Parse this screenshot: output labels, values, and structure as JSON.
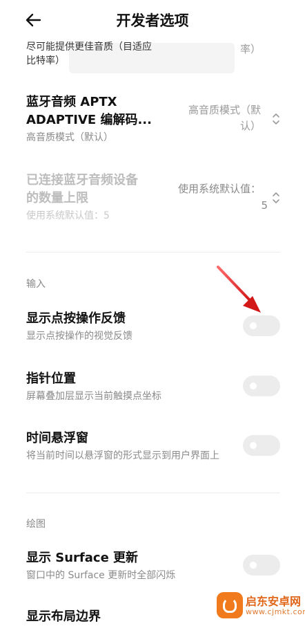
{
  "header": {
    "title": "开发者选项"
  },
  "top_partial": {
    "line1": "尽可能提供更佳音质（目适应",
    "line2": "比特率）",
    "value_tail": "率）"
  },
  "aptx": {
    "title_line1": "蓝牙音频 APTX",
    "title_line2": "ADAPTIVE 编解码...",
    "subtitle": "高音质模式（默认）",
    "value_line1": "高音质模式（默",
    "value_line2": "认）"
  },
  "bt_limit": {
    "title_line1": "已连接蓝牙音频设备",
    "title_line2": "的数量上限",
    "subtitle": "使用系统默认值：5",
    "value_line1": "使用系统默认值：",
    "value_line2": "5"
  },
  "section_input": "输入",
  "show_taps": {
    "title": "显示点按操作反馈",
    "subtitle": "显示点按操作的视觉反馈",
    "enabled": false
  },
  "pointer_location": {
    "title": "指针位置",
    "subtitle": "屏幕叠加层显示当前触摸点坐标",
    "enabled": false
  },
  "time_float": {
    "title": "时间悬浮窗",
    "subtitle": "将当前时间以悬浮窗的形式显示到用户界面上",
    "enabled": false
  },
  "section_drawing": "绘图",
  "surface_updates": {
    "title": "显示 Surface 更新",
    "subtitle": "窗口中的 Surface 更新时全部闪烁",
    "enabled": false
  },
  "layout_bounds": {
    "title": "显示布局边界"
  },
  "watermark": {
    "name": "启东安卓网",
    "url": "www.cjmkt.com"
  },
  "colors": {
    "arrow": "#e02424",
    "toggle_off": "#ececec",
    "watermark": "#f07a1c"
  }
}
